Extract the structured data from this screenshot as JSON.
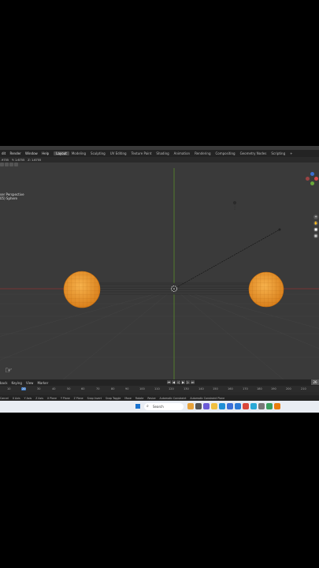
{
  "header": {
    "menus": [
      "dit",
      "Render",
      "Window",
      "Help"
    ],
    "tabs": [
      "Layout",
      "Modeling",
      "Sculpting",
      "UV Editing",
      "Texture Paint",
      "Shading",
      "Animation",
      "Rendering",
      "Compositing",
      "Geometry Nodes",
      "Scripting"
    ],
    "active_tab": "Layout",
    "add_tab": "+"
  },
  "toolbar": {
    "coords": [
      ".9755",
      "Y: 1.6755",
      "Z: 1.6755"
    ]
  },
  "viewport": {
    "view_name": "ser Perspective",
    "object_name": "05) Sphere"
  },
  "timeline": {
    "menus": [
      "back",
      "Keying",
      "View",
      "Marker"
    ],
    "current_frame": "26",
    "ticks": [
      "10",
      "20",
      "30",
      "40",
      "50",
      "60",
      "70",
      "80",
      "90",
      "100",
      "110",
      "120",
      "130",
      "140",
      "150",
      "160",
      "170",
      "180",
      "190",
      "200",
      "210"
    ],
    "current_tick": "20"
  },
  "statusbar": {
    "items": [
      "Cancel",
      "X Axis",
      "Y Axis",
      "Z Axis",
      "X Plane",
      "Y Plane",
      "Z Plane",
      "Snap Invert",
      "Snap Toggle",
      "Move",
      "Rotate",
      "Resize",
      "Automatic Constraint",
      "Automatic Constraint Plane"
    ]
  },
  "taskbar": {
    "search_label": "Search"
  },
  "colors": {
    "selection": "#f5a33a",
    "x_axis": "#a33",
    "y_axis": "#6a3",
    "active_tab": "#4a4a4a"
  }
}
